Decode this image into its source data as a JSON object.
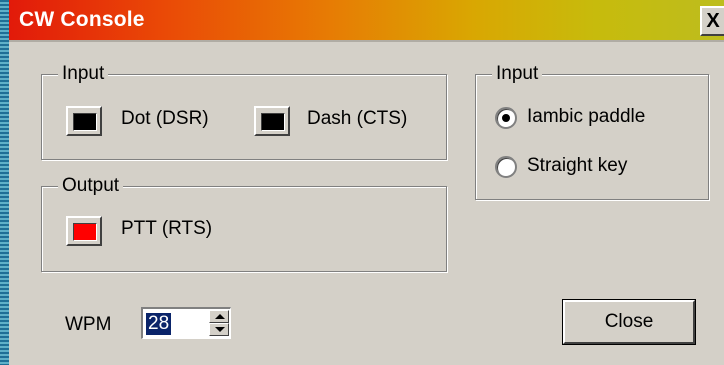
{
  "window": {
    "title": "CW Console",
    "close_glyph": "X"
  },
  "input_lines": {
    "legend": "Input",
    "dot": {
      "label": "Dot (DSR)",
      "color": "#000000"
    },
    "dash": {
      "label": "Dash (CTS)",
      "color": "#000000"
    }
  },
  "output_lines": {
    "legend": "Output",
    "ptt": {
      "label": "PTT (RTS)",
      "color": "#ff0000"
    }
  },
  "input_mode": {
    "legend": "Input",
    "options": [
      {
        "label": "Iambic paddle",
        "selected": true
      },
      {
        "label": "Straight key",
        "selected": false
      }
    ]
  },
  "wpm": {
    "label": "WPM",
    "value": "28"
  },
  "buttons": {
    "close_label": "Close"
  },
  "icons": {
    "spin_up": "arrow-up-icon",
    "spin_down": "arrow-down-icon"
  }
}
